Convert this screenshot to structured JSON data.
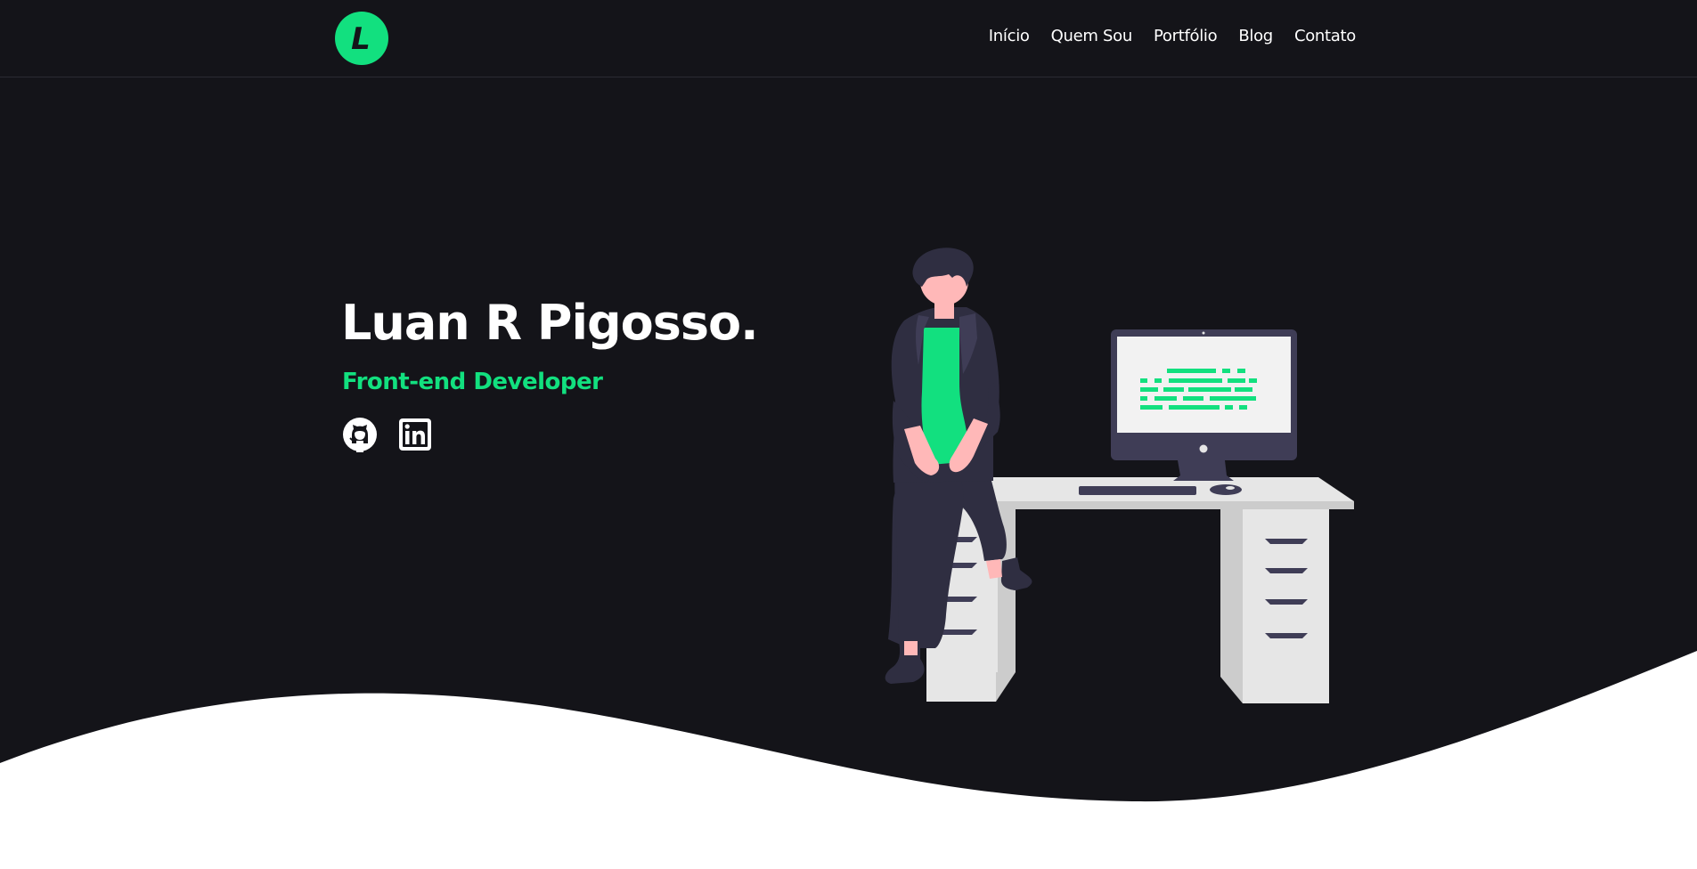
{
  "brand": {
    "logo_letter": "L",
    "accent_color": "#12e07f",
    "background_color": "#141419"
  },
  "nav": {
    "items": [
      {
        "label": "Início"
      },
      {
        "label": "Quem Sou"
      },
      {
        "label": "Portfólio"
      },
      {
        "label": "Blog"
      },
      {
        "label": "Contato"
      }
    ]
  },
  "hero": {
    "title": "Luan R Pigosso.",
    "subtitle": "Front-end Developer",
    "social": [
      {
        "icon": "github-icon"
      },
      {
        "icon": "linkedin-icon"
      }
    ],
    "illustration": "developer-at-desk"
  }
}
